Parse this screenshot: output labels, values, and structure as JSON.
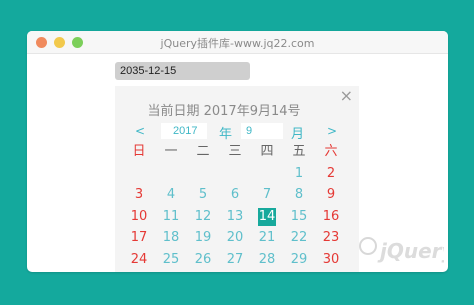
{
  "window": {
    "title": "jQuery插件库-www.jq22.com"
  },
  "input": {
    "value": "2035-12-15"
  },
  "picker": {
    "close_label": "×",
    "current_label": "当前日期 2017年9月14号",
    "prev": "<",
    "next": ">",
    "year_value": "2017",
    "year_unit": "年",
    "month_value": "9",
    "month_unit": "月",
    "weekdays": [
      "日",
      "一",
      "二",
      "三",
      "四",
      "五",
      "六"
    ],
    "weeks": [
      [
        "",
        "",
        "",
        "",
        "",
        "1",
        "2"
      ],
      [
        "3",
        "4",
        "5",
        "6",
        "7",
        "8",
        "9"
      ],
      [
        "10",
        "11",
        "12",
        "13",
        "14",
        "15",
        "16"
      ],
      [
        "17",
        "18",
        "19",
        "20",
        "21",
        "22",
        "23"
      ],
      [
        "24",
        "25",
        "26",
        "27",
        "28",
        "29",
        "30"
      ]
    ],
    "today": "14"
  },
  "colors": {
    "background": "#14a99d",
    "accent": "#17a99c",
    "weekend": "#e53935",
    "day": "#5fbfcb"
  }
}
